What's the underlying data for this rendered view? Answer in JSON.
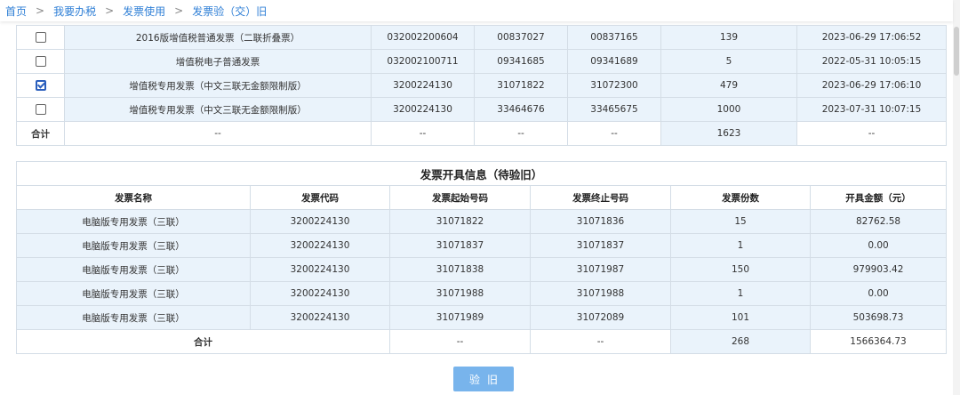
{
  "breadcrumb": {
    "items": [
      "首页",
      "我要办税",
      "发票使用",
      "发票验（交）旧"
    ],
    "separator": ">"
  },
  "inventory_table": {
    "rows": [
      {
        "checked": false,
        "name": "2016版增值税普通发票（二联折叠票）",
        "code": "032002200604",
        "start": "00837027",
        "end": "00837165",
        "count": "139",
        "time": "2023-06-29 17:06:52"
      },
      {
        "checked": false,
        "name": "增值税电子普通发票",
        "code": "032002100711",
        "start": "09341685",
        "end": "09341689",
        "count": "5",
        "time": "2022-05-31 10:05:15"
      },
      {
        "checked": true,
        "name": "增值税专用发票（中文三联无金额限制版）",
        "code": "3200224130",
        "start": "31071822",
        "end": "31072300",
        "count": "479",
        "time": "2023-06-29 17:06:10"
      },
      {
        "checked": false,
        "name": "增值税专用发票（中文三联无金额限制版）",
        "code": "3200224130",
        "start": "33464676",
        "end": "33465675",
        "count": "1000",
        "time": "2023-07-31 10:07:15"
      }
    ],
    "total": {
      "label": "合计",
      "name": "--",
      "code": "--",
      "start": "--",
      "end": "--",
      "count": "1623",
      "time": "--"
    }
  },
  "issued_table": {
    "title": "发票开具信息（待验旧）",
    "headers": [
      "发票名称",
      "发票代码",
      "发票起始号码",
      "发票终止号码",
      "发票份数",
      "开具金额（元）"
    ],
    "rows": [
      {
        "name": "电脑版专用发票（三联）",
        "code": "3200224130",
        "start": "31071822",
        "end": "31071836",
        "count": "15",
        "amount": "82762.58"
      },
      {
        "name": "电脑版专用发票（三联）",
        "code": "3200224130",
        "start": "31071837",
        "end": "31071837",
        "count": "1",
        "amount": "0.00"
      },
      {
        "name": "电脑版专用发票（三联）",
        "code": "3200224130",
        "start": "31071838",
        "end": "31071987",
        "count": "150",
        "amount": "979903.42"
      },
      {
        "name": "电脑版专用发票（三联）",
        "code": "3200224130",
        "start": "31071988",
        "end": "31071988",
        "count": "1",
        "amount": "0.00"
      },
      {
        "name": "电脑版专用发票（三联）",
        "code": "3200224130",
        "start": "31071989",
        "end": "31072089",
        "count": "101",
        "amount": "503698.73"
      }
    ],
    "total": {
      "label": "合计",
      "start": "--",
      "end": "--",
      "count": "268",
      "amount": "1566364.73"
    }
  },
  "actions": {
    "verify_label": "验旧"
  },
  "colors": {
    "accent": "#2f7fd6",
    "row_highlight": "#eaf3fb",
    "button": "#78b4ec",
    "border": "#d4dde6"
  }
}
